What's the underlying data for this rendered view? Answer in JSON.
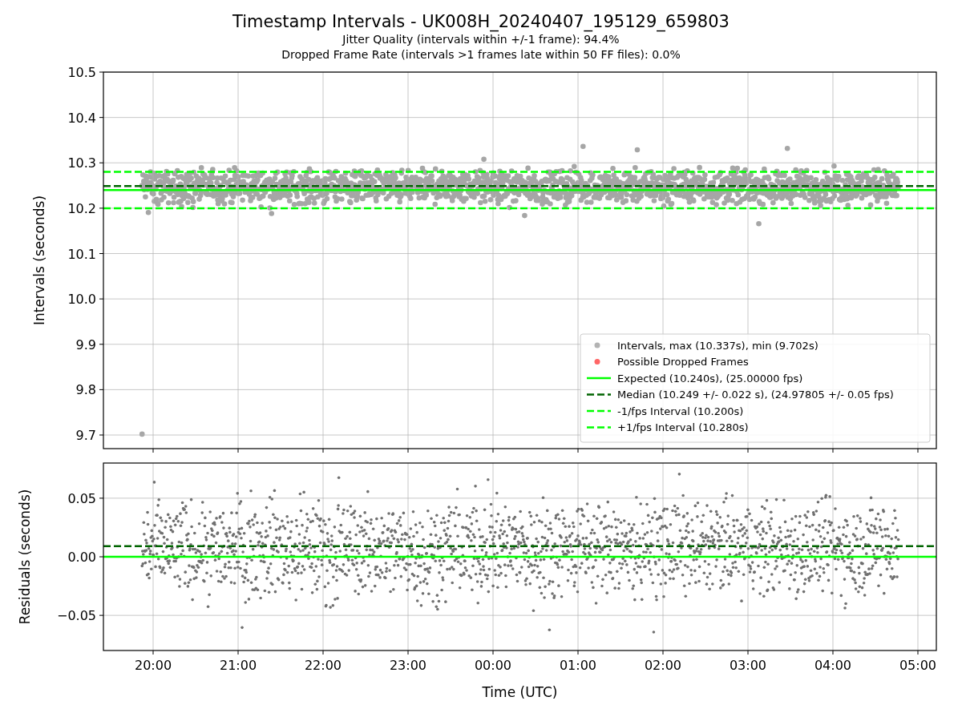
{
  "figure": {
    "title": "Timestamp Intervals - UK008H_20240407_195129_659803",
    "subtitles": [
      "Jitter Quality (intervals within +/-1 frame): 94.4%",
      "Dropped Frame Rate (intervals >1 frames late within 50 FF files): 0.0%"
    ]
  },
  "intervals_panel": {
    "legend_markers": [
      {
        "label": "Intervals, max (10.337s), min (9.702s)",
        "color": "#b3b3b3"
      },
      {
        "label": "Possible Dropped Frames",
        "color": "#ff6666"
      }
    ],
    "chart_data": {
      "type": "scatter",
      "ylabel": "Intervals (seconds)",
      "grid": true,
      "legend": "lower right",
      "categories": [
        null,
        null,
        null,
        null,
        null,
        null,
        null,
        null,
        null,
        null
      ],
      "ylim": [
        9.67,
        10.5
      ],
      "yticks": [
        {
          "value": 9.7,
          "label": "9.7"
        },
        {
          "value": 9.8,
          "label": "9.8"
        },
        {
          "value": 9.9,
          "label": "9.9"
        },
        {
          "value": 10.0,
          "label": "10.0"
        },
        {
          "value": 10.1,
          "label": "10.1"
        },
        {
          "value": 10.2,
          "label": "10.2"
        },
        {
          "value": 10.3,
          "label": "10.3"
        },
        {
          "value": 10.4,
          "label": "10.4"
        },
        {
          "value": 10.5,
          "label": "10.5"
        }
      ],
      "ref_lines": [
        {
          "axis": "y",
          "value": 10.24,
          "label": "Expected (10.240s), (25.00000 fps)",
          "color": "#00ff00"
        },
        {
          "axis": "y",
          "value": 10.249,
          "label": "Median (10.249 +/- 0.022 s), (24.97805 +/- 0.05 fps)",
          "color": "#006400"
        },
        {
          "axis": "y",
          "value": 10.2,
          "label": "-1/fps Interval (10.200s)",
          "color": "#00ff00"
        },
        {
          "axis": "y",
          "value": 10.28,
          "label": "+1/fps Interval (10.280s)",
          "color": "#00ff00"
        }
      ]
    }
  },
  "residuals_panel": {
    "chart_data": {
      "type": "scatter",
      "xlabel": "Time (UTC)",
      "ylabel": "Residuals (seconds)",
      "grid": true,
      "categories": [
        "20:00",
        "21:00",
        "22:00",
        "23:00",
        "00:00",
        "01:00",
        "02:00",
        "03:00",
        "04:00",
        "05:00"
      ],
      "ylim": [
        -0.08,
        0.08
      ],
      "yticks": [
        {
          "value": -0.05,
          "label": "−0.05"
        },
        {
          "value": 0.0,
          "label": "0.00"
        },
        {
          "value": 0.05,
          "label": "0.05"
        }
      ],
      "ref_lines": [
        {
          "axis": "y",
          "value": 0.009,
          "color": "#006400"
        },
        {
          "axis": "y",
          "value": 0,
          "color": "#00ff00"
        }
      ]
    }
  }
}
